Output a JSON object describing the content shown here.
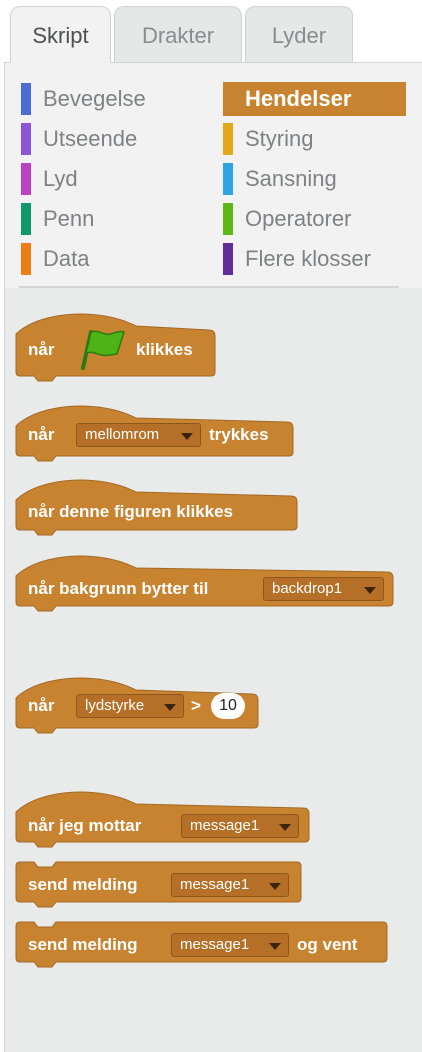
{
  "tabs": [
    "Skript",
    "Drakter",
    "Lyder"
  ],
  "categories": [
    {
      "label": "Bevegelse",
      "color": "#4a6cd4"
    },
    {
      "label": "Hendelser",
      "color": "#c88330"
    },
    {
      "label": "Utseende",
      "color": "#8a55d7"
    },
    {
      "label": "Styring",
      "color": "#e1a91a"
    },
    {
      "label": "Lyd",
      "color": "#bb42c3"
    },
    {
      "label": "Sansning",
      "color": "#2ca5e2"
    },
    {
      "label": "Penn",
      "color": "#0e9a6c"
    },
    {
      "label": "Operatorer",
      "color": "#5cb712"
    },
    {
      "label": "Data",
      "color": "#ee7d16"
    },
    {
      "label": "Flere klosser",
      "color": "#632d99"
    }
  ],
  "selected_category": "Hendelser",
  "block_color": "#c88330",
  "blocks": {
    "flag": {
      "when": "når",
      "clicked": "klikkes"
    },
    "key": {
      "when": "når",
      "key": "mellomrom",
      "pressed": "trykkes"
    },
    "sprite": {
      "text": "når denne figuren klikkes"
    },
    "backdrop": {
      "text": "når bakgrunn bytter til",
      "backdrop": "backdrop1"
    },
    "loudness": {
      "when": "når",
      "sensor": "lydstyrke",
      "op": ">",
      "value": "10"
    },
    "receive": {
      "text": "når jeg mottar",
      "message": "message1"
    },
    "broadcast": {
      "text": "send melding",
      "message": "message1"
    },
    "broadcast_wait": {
      "text": "send melding",
      "message": "message1",
      "suffix": "og vent"
    }
  }
}
